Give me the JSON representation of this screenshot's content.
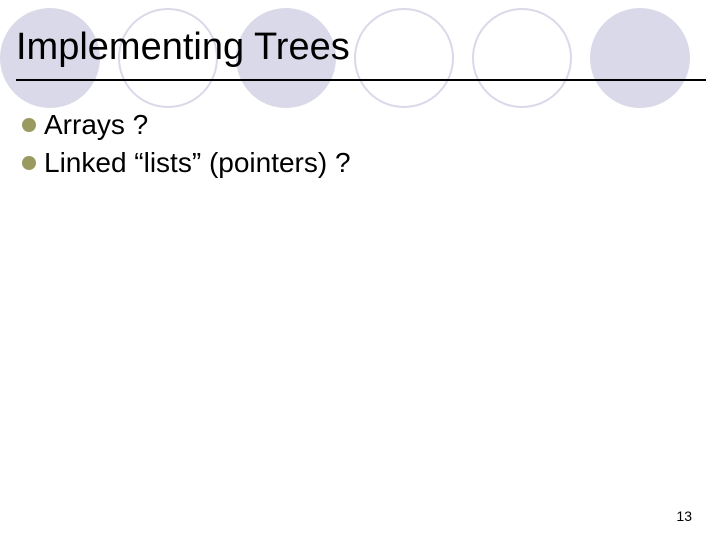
{
  "slide": {
    "title": "Implementing Trees",
    "bullets": [
      {
        "text": "Arrays ?"
      },
      {
        "text": "Linked “lists” (pointers) ?"
      }
    ],
    "page_number": "13"
  }
}
